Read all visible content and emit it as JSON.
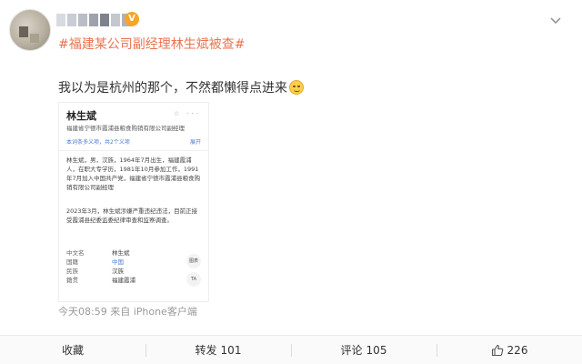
{
  "post": {
    "topic": "#福建某公司副经理林生斌被查#",
    "text": "我以为是杭州的那个，不然都懒得点进来",
    "emoji_icon": "smirk-emoji-icon",
    "meta": "今天08:59  来自 iPhone客户端"
  },
  "card": {
    "title": "林生斌",
    "tools": "☆ ···",
    "subtitle": "福建省宁德市霞浦县粮食购销有限公司副经理",
    "link_left": "本词条多义项，共2个义项",
    "link_right": "展开",
    "bio": "林生斌，男，汉族，1964年7月出生，福建霞浦人，在职大专学历，1981年10月参加工作，1991年7月加入中国共产党，福建省宁德市霞浦县粮食购销有限公司副经理",
    "news": "2023年3月，林生斌涉嫌严重违纪违法，目前正接受霞浦县纪委监委纪律审查和监察调查。",
    "info": [
      {
        "key": "中文名",
        "value": "林生斌"
      },
      {
        "key": "国籍",
        "value": "中国"
      },
      {
        "key": "民族",
        "value": "汉族"
      },
      {
        "key": "籍贯",
        "value": "福建霞浦"
      }
    ],
    "side_btn_1": "图表",
    "side_btn_2": "TA"
  },
  "actions": {
    "favorite_label": "收藏",
    "repost_label": "转发",
    "repost_count": "101",
    "comment_label": "评论",
    "comment_count": "105",
    "like_count": "226"
  },
  "colors": {
    "topic": "#eb7350",
    "link": "#4b7bd4",
    "vip_badge": "#f6a623"
  }
}
